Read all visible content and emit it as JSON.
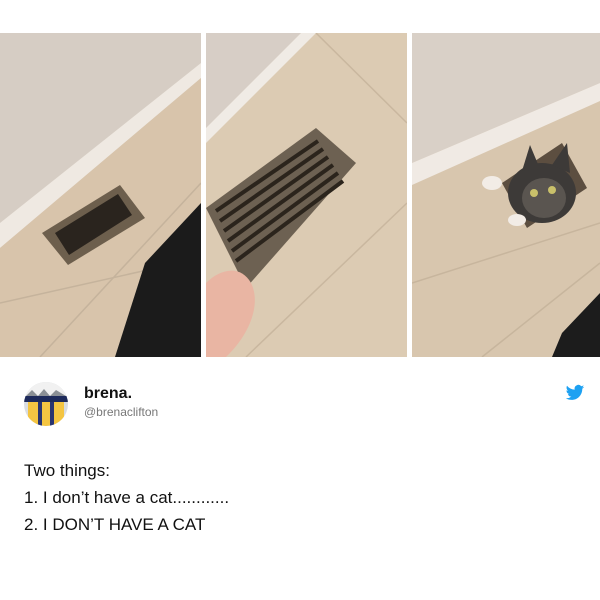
{
  "tweet": {
    "display_name": "brena.",
    "handle": "@brenaclifton",
    "lines": [
      "Two things:",
      "1. I don’t have a cat............",
      "2. I DON’T HAVE A CAT"
    ]
  },
  "icons": {
    "brand": "twitter-bird-icon",
    "avatar": "profile-avatar"
  },
  "colors": {
    "twitter_blue": "#1da1f2",
    "floor_tile": "#d8c5ad",
    "wall": "#d9cfc5",
    "vent": "#6e6050"
  }
}
